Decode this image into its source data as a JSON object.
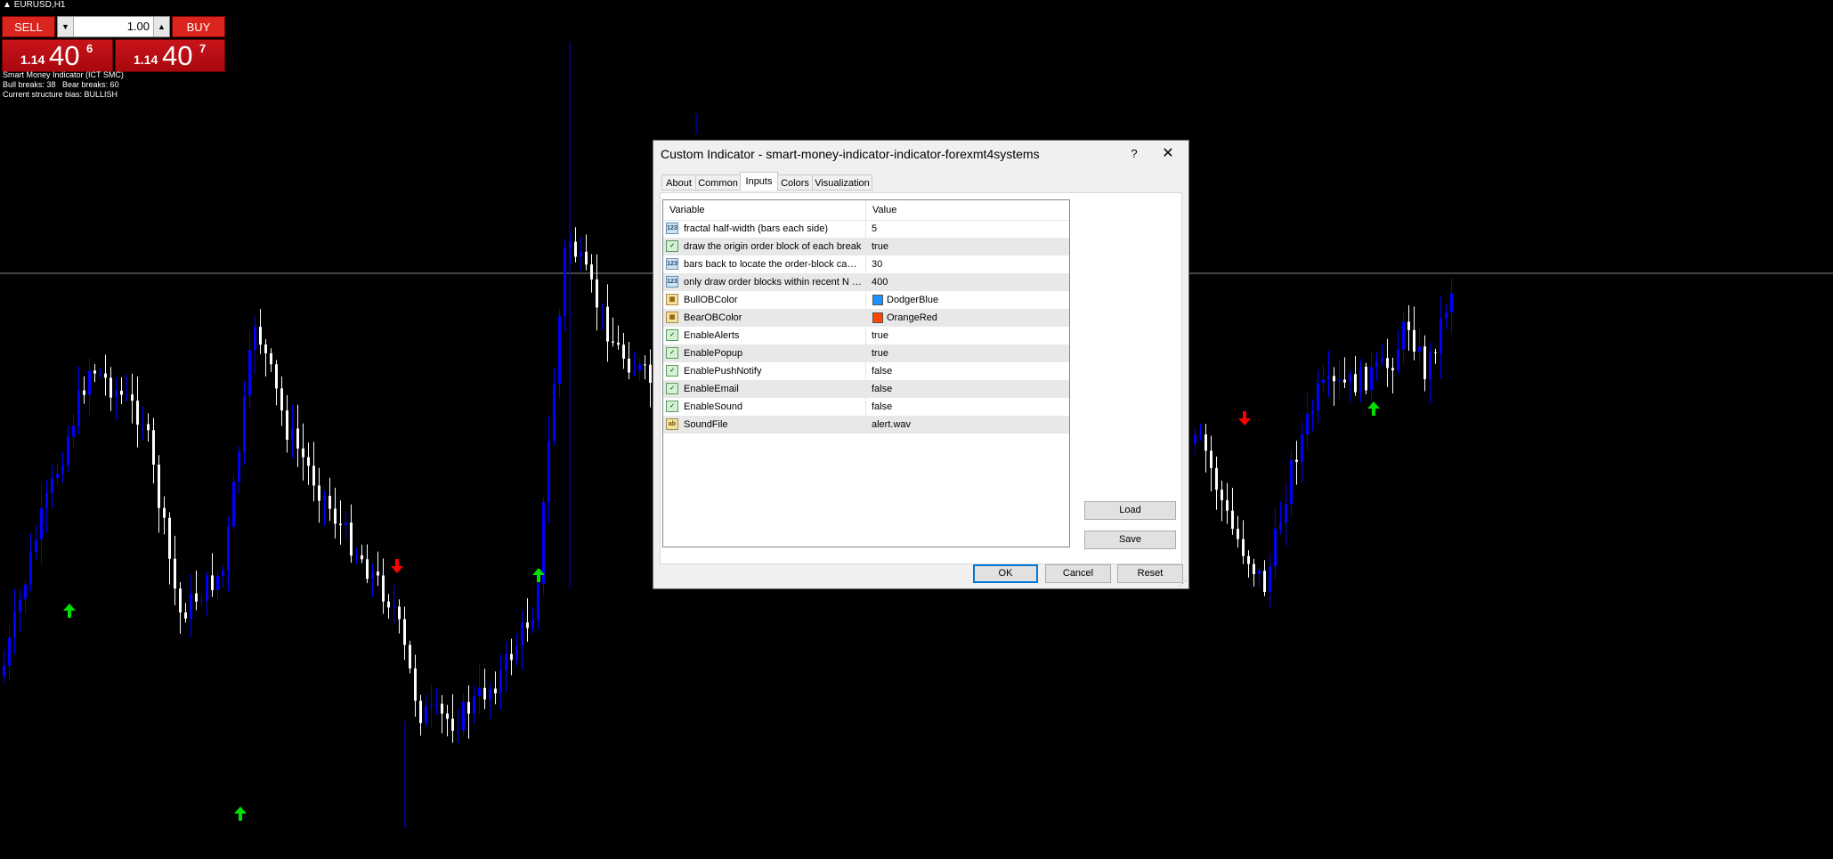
{
  "chart": {
    "symbol": "EURUSD,H1",
    "trade_panel": {
      "sell_label": "SELL",
      "buy_label": "BUY",
      "lot_value": "1.00",
      "bid": {
        "small": "1.14",
        "big": "40",
        "sup": "6"
      },
      "ask": {
        "small": "1.14",
        "big": "40",
        "sup": "7"
      }
    },
    "info": {
      "line1": "Smart Money Indicator (ICT SMC)",
      "line2": "Bull breaks: 38   Bear breaks: 60",
      "line3": "Current structure bias: BULLISH"
    },
    "colors": {
      "bull_candle": "#0000ff",
      "bear_candle": "#ffffff",
      "up_arrow": "#00e000",
      "down_arrow": "#ff0000",
      "background": "#000000"
    },
    "horizontal_line_price_label": ""
  },
  "dialog": {
    "title": "Custom Indicator - smart-money-indicator-indicator-forexmt4systems",
    "help_label": "?",
    "close_label": "✕",
    "tabs": [
      {
        "label": "About"
      },
      {
        "label": "Common"
      },
      {
        "label": "Inputs"
      },
      {
        "label": "Colors"
      },
      {
        "label": "Visualization"
      }
    ],
    "active_tab": "Inputs",
    "grid": {
      "header_variable": "Variable",
      "header_value": "Value",
      "rows": [
        {
          "icon": "123",
          "type": "num",
          "variable": "fractal half-width (bars each side)",
          "value": "5"
        },
        {
          "icon": "bool",
          "type": "bool",
          "variable": "draw the origin order block of each break",
          "value": "true"
        },
        {
          "icon": "123",
          "type": "num",
          "variable": "bars back to locate the order-block candle",
          "value": "30"
        },
        {
          "icon": "123",
          "type": "num",
          "variable": "only draw order blocks within recent N b...",
          "value": "400"
        },
        {
          "icon": "clr",
          "type": "color",
          "variable": "BullOBColor",
          "value": "DodgerBlue",
          "swatch": "#1e90ff"
        },
        {
          "icon": "clr",
          "type": "color",
          "variable": "BearOBColor",
          "value": "OrangeRed",
          "swatch": "#ff4500"
        },
        {
          "icon": "bool",
          "type": "bool",
          "variable": "EnableAlerts",
          "value": "true"
        },
        {
          "icon": "bool",
          "type": "bool",
          "variable": "EnablePopup",
          "value": "true"
        },
        {
          "icon": "bool",
          "type": "bool",
          "variable": "EnablePushNotify",
          "value": "false"
        },
        {
          "icon": "bool",
          "type": "bool",
          "variable": "EnableEmail",
          "value": "false"
        },
        {
          "icon": "bool",
          "type": "bool",
          "variable": "EnableSound",
          "value": "false"
        },
        {
          "icon": "ab",
          "type": "str",
          "variable": "SoundFile",
          "value": "alert.wav"
        }
      ]
    },
    "buttons": {
      "load": "Load",
      "save": "Save",
      "ok": "OK",
      "cancel": "Cancel",
      "reset": "Reset"
    }
  }
}
